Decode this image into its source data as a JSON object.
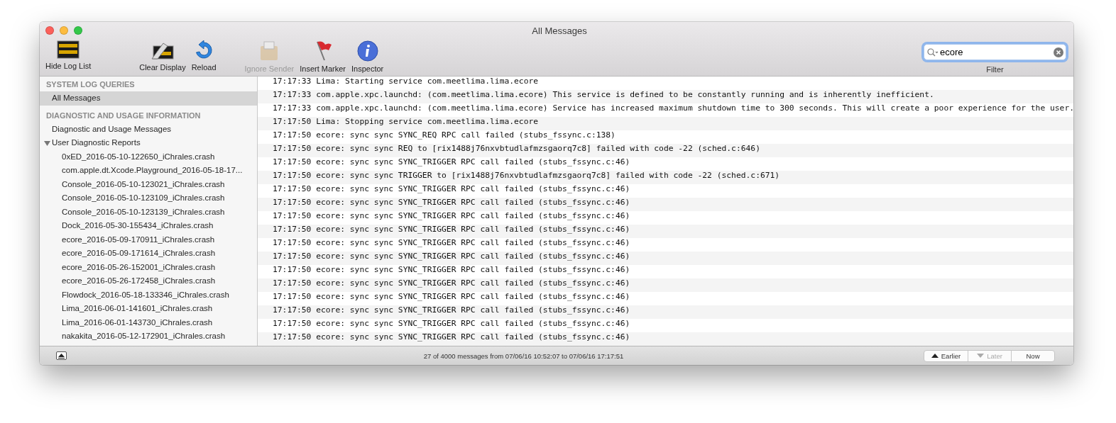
{
  "window": {
    "title": "All Messages"
  },
  "toolbar": {
    "groups": [
      [
        {
          "label": "Hide Log List",
          "kind": "display",
          "disabled": false
        }
      ],
      [
        {
          "label": "Clear Display",
          "kind": "clear",
          "disabled": false
        },
        {
          "label": "Reload",
          "kind": "reload",
          "disabled": false
        }
      ],
      [
        {
          "label": "Ignore Sender",
          "kind": "envelope",
          "disabled": true
        },
        {
          "label": "Insert Marker",
          "kind": "flag",
          "disabled": false
        },
        {
          "label": "Inspector",
          "kind": "info",
          "disabled": false
        }
      ]
    ]
  },
  "search": {
    "value": "ecore",
    "label": "Filter"
  },
  "sidebar": {
    "sections": [
      {
        "title": "SYSTEM LOG QUERIES",
        "items": [
          {
            "label": "All Messages",
            "selected": true
          }
        ]
      },
      {
        "title": "DIAGNOSTIC AND USAGE INFORMATION",
        "items": [
          {
            "label": "Diagnostic and Usage Messages",
            "selected": false
          },
          {
            "label": "User Diagnostic Reports",
            "selected": false,
            "expanded": true,
            "children": [
              {
                "label": "0xED_2016-05-10-122650_iChrales.crash",
                "selected": false
              },
              {
                "label": "com.apple.dt.Xcode.Playground_2016-05-18-17...",
                "selected": false
              },
              {
                "label": "Console_2016-05-10-123021_iChrales.crash",
                "selected": false
              },
              {
                "label": "Console_2016-05-10-123109_iChrales.crash",
                "selected": false
              },
              {
                "label": "Console_2016-05-10-123139_iChrales.crash",
                "selected": false
              },
              {
                "label": "Dock_2016-05-30-155434_iChrales.crash",
                "selected": false
              },
              {
                "label": "ecore_2016-05-09-170911_iChrales.crash",
                "selected": false
              },
              {
                "label": "ecore_2016-05-09-171614_iChrales.crash",
                "selected": false
              },
              {
                "label": "ecore_2016-05-26-152001_iChrales.crash",
                "selected": false
              },
              {
                "label": "ecore_2016-05-26-172458_iChrales.crash",
                "selected": false
              },
              {
                "label": "Flowdock_2016-05-18-133346_iChrales.crash",
                "selected": false
              },
              {
                "label": "Lima_2016-06-01-141601_iChrales.crash",
                "selected": false
              },
              {
                "label": "Lima_2016-06-01-143730_iChrales.crash",
                "selected": false
              },
              {
                "label": "nakakita_2016-05-12-172901_iChrales.crash",
                "selected": false
              }
            ]
          }
        ]
      }
    ]
  },
  "log": {
    "rows": [
      "17:17:33 Lima: Starting service com.meetlima.lima.ecore",
      "17:17:33 com.apple.xpc.launchd: (com.meetlima.lima.ecore) This service is defined to be constantly running and is inherently inefficient.",
      "17:17:33 com.apple.xpc.launchd: (com.meetlima.lima.ecore) Service has increased maximum shutdown time to 300 seconds. This will create a poor experience for the user.",
      "17:17:50 Lima: Stopping service com.meetlima.lima.ecore",
      "17:17:50 ecore: sync sync SYNC_REQ RPC call failed (stubs_fssync.c:138)",
      "17:17:50 ecore: sync sync REQ to [rix1488j76nxvbtudlafmzsgaorq7c8] failed with code -22 (sched.c:646)",
      "17:17:50 ecore: sync sync SYNC_TRIGGER RPC call failed (stubs_fssync.c:46)",
      "17:17:50 ecore: sync sync TRIGGER to [rix1488j76nxvbtudlafmzsgaorq7c8] failed with code -22 (sched.c:671)",
      "17:17:50 ecore: sync sync SYNC_TRIGGER RPC call failed (stubs_fssync.c:46)",
      "17:17:50 ecore: sync sync SYNC_TRIGGER RPC call failed (stubs_fssync.c:46)",
      "17:17:50 ecore: sync sync SYNC_TRIGGER RPC call failed (stubs_fssync.c:46)",
      "17:17:50 ecore: sync sync SYNC_TRIGGER RPC call failed (stubs_fssync.c:46)",
      "17:17:50 ecore: sync sync SYNC_TRIGGER RPC call failed (stubs_fssync.c:46)",
      "17:17:50 ecore: sync sync SYNC_TRIGGER RPC call failed (stubs_fssync.c:46)",
      "17:17:50 ecore: sync sync SYNC_TRIGGER RPC call failed (stubs_fssync.c:46)",
      "17:17:50 ecore: sync sync SYNC_TRIGGER RPC call failed (stubs_fssync.c:46)",
      "17:17:50 ecore: sync sync SYNC_TRIGGER RPC call failed (stubs_fssync.c:46)",
      "17:17:50 ecore: sync sync SYNC_TRIGGER RPC call failed (stubs_fssync.c:46)",
      "17:17:50 ecore: sync sync SYNC_TRIGGER RPC call failed (stubs_fssync.c:46)",
      "17:17:50 ecore: sync sync SYNC_TRIGGER RPC call failed (stubs_fssync.c:46)"
    ]
  },
  "status_bar": {
    "text": "27 of 4000 messages from 07/06/16 10:52:07 to 07/06/16 17:17:51",
    "buttons": [
      {
        "label": "Earlier",
        "kind": "up",
        "disabled": false
      },
      {
        "label": "Later",
        "kind": "down",
        "disabled": true
      },
      {
        "label": "Now",
        "kind": "plain",
        "disabled": false
      }
    ]
  }
}
